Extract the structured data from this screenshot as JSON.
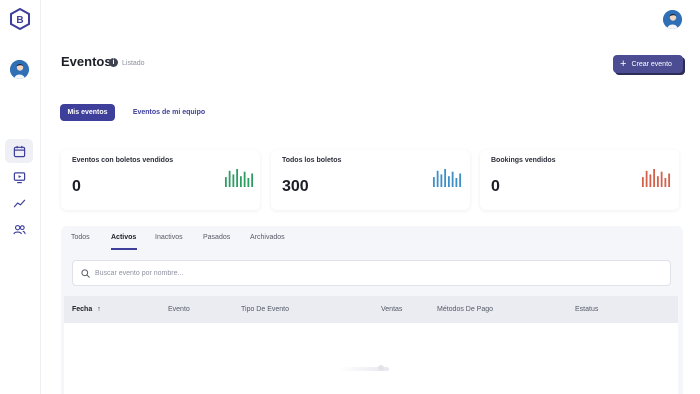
{
  "header": {
    "title": "Eventos",
    "subtitle": "Listado",
    "create_label": "Crear evento"
  },
  "toggle_tabs": [
    {
      "label": "Mis eventos",
      "active": true
    },
    {
      "label": "Eventos de mi equipo",
      "active": false
    }
  ],
  "stats": [
    {
      "label": "Eventos con boletos vendidos",
      "value": "0",
      "color": "#2e9d62",
      "bars": [
        0.55,
        0.9,
        0.7,
        1.0,
        0.6,
        0.85,
        0.5,
        0.75
      ]
    },
    {
      "label": "Todos los boletos",
      "value": "300",
      "color": "#3d8fc6",
      "bars": [
        0.55,
        0.9,
        0.7,
        1.0,
        0.6,
        0.85,
        0.5,
        0.75
      ]
    },
    {
      "label": "Bookings vendidos",
      "value": "0",
      "color": "#d4604a",
      "bars": [
        0.55,
        0.9,
        0.7,
        1.0,
        0.6,
        0.85,
        0.5,
        0.75
      ]
    }
  ],
  "sub_tabs": [
    {
      "label": "Todos"
    },
    {
      "label": "Activos",
      "active": true
    },
    {
      "label": "Inactivos"
    },
    {
      "label": "Pasados"
    },
    {
      "label": "Archivados"
    }
  ],
  "search": {
    "placeholder": "Buscar evento por nombre...",
    "value": ""
  },
  "table": {
    "columns": [
      "Fecha",
      "Evento",
      "Tipo De Evento",
      "Ventas",
      "Métodos De Pago",
      "Estatus"
    ],
    "sort_column": "Fecha",
    "sort_direction": "ascending"
  },
  "icons": {
    "logo": "brand-b-logo",
    "nav": [
      "calendar-icon",
      "monitor-icon",
      "trend-line-icon",
      "users-icon"
    ]
  },
  "colors": {
    "accent": "#3e3f9a",
    "create_button": "#4b4c92"
  }
}
